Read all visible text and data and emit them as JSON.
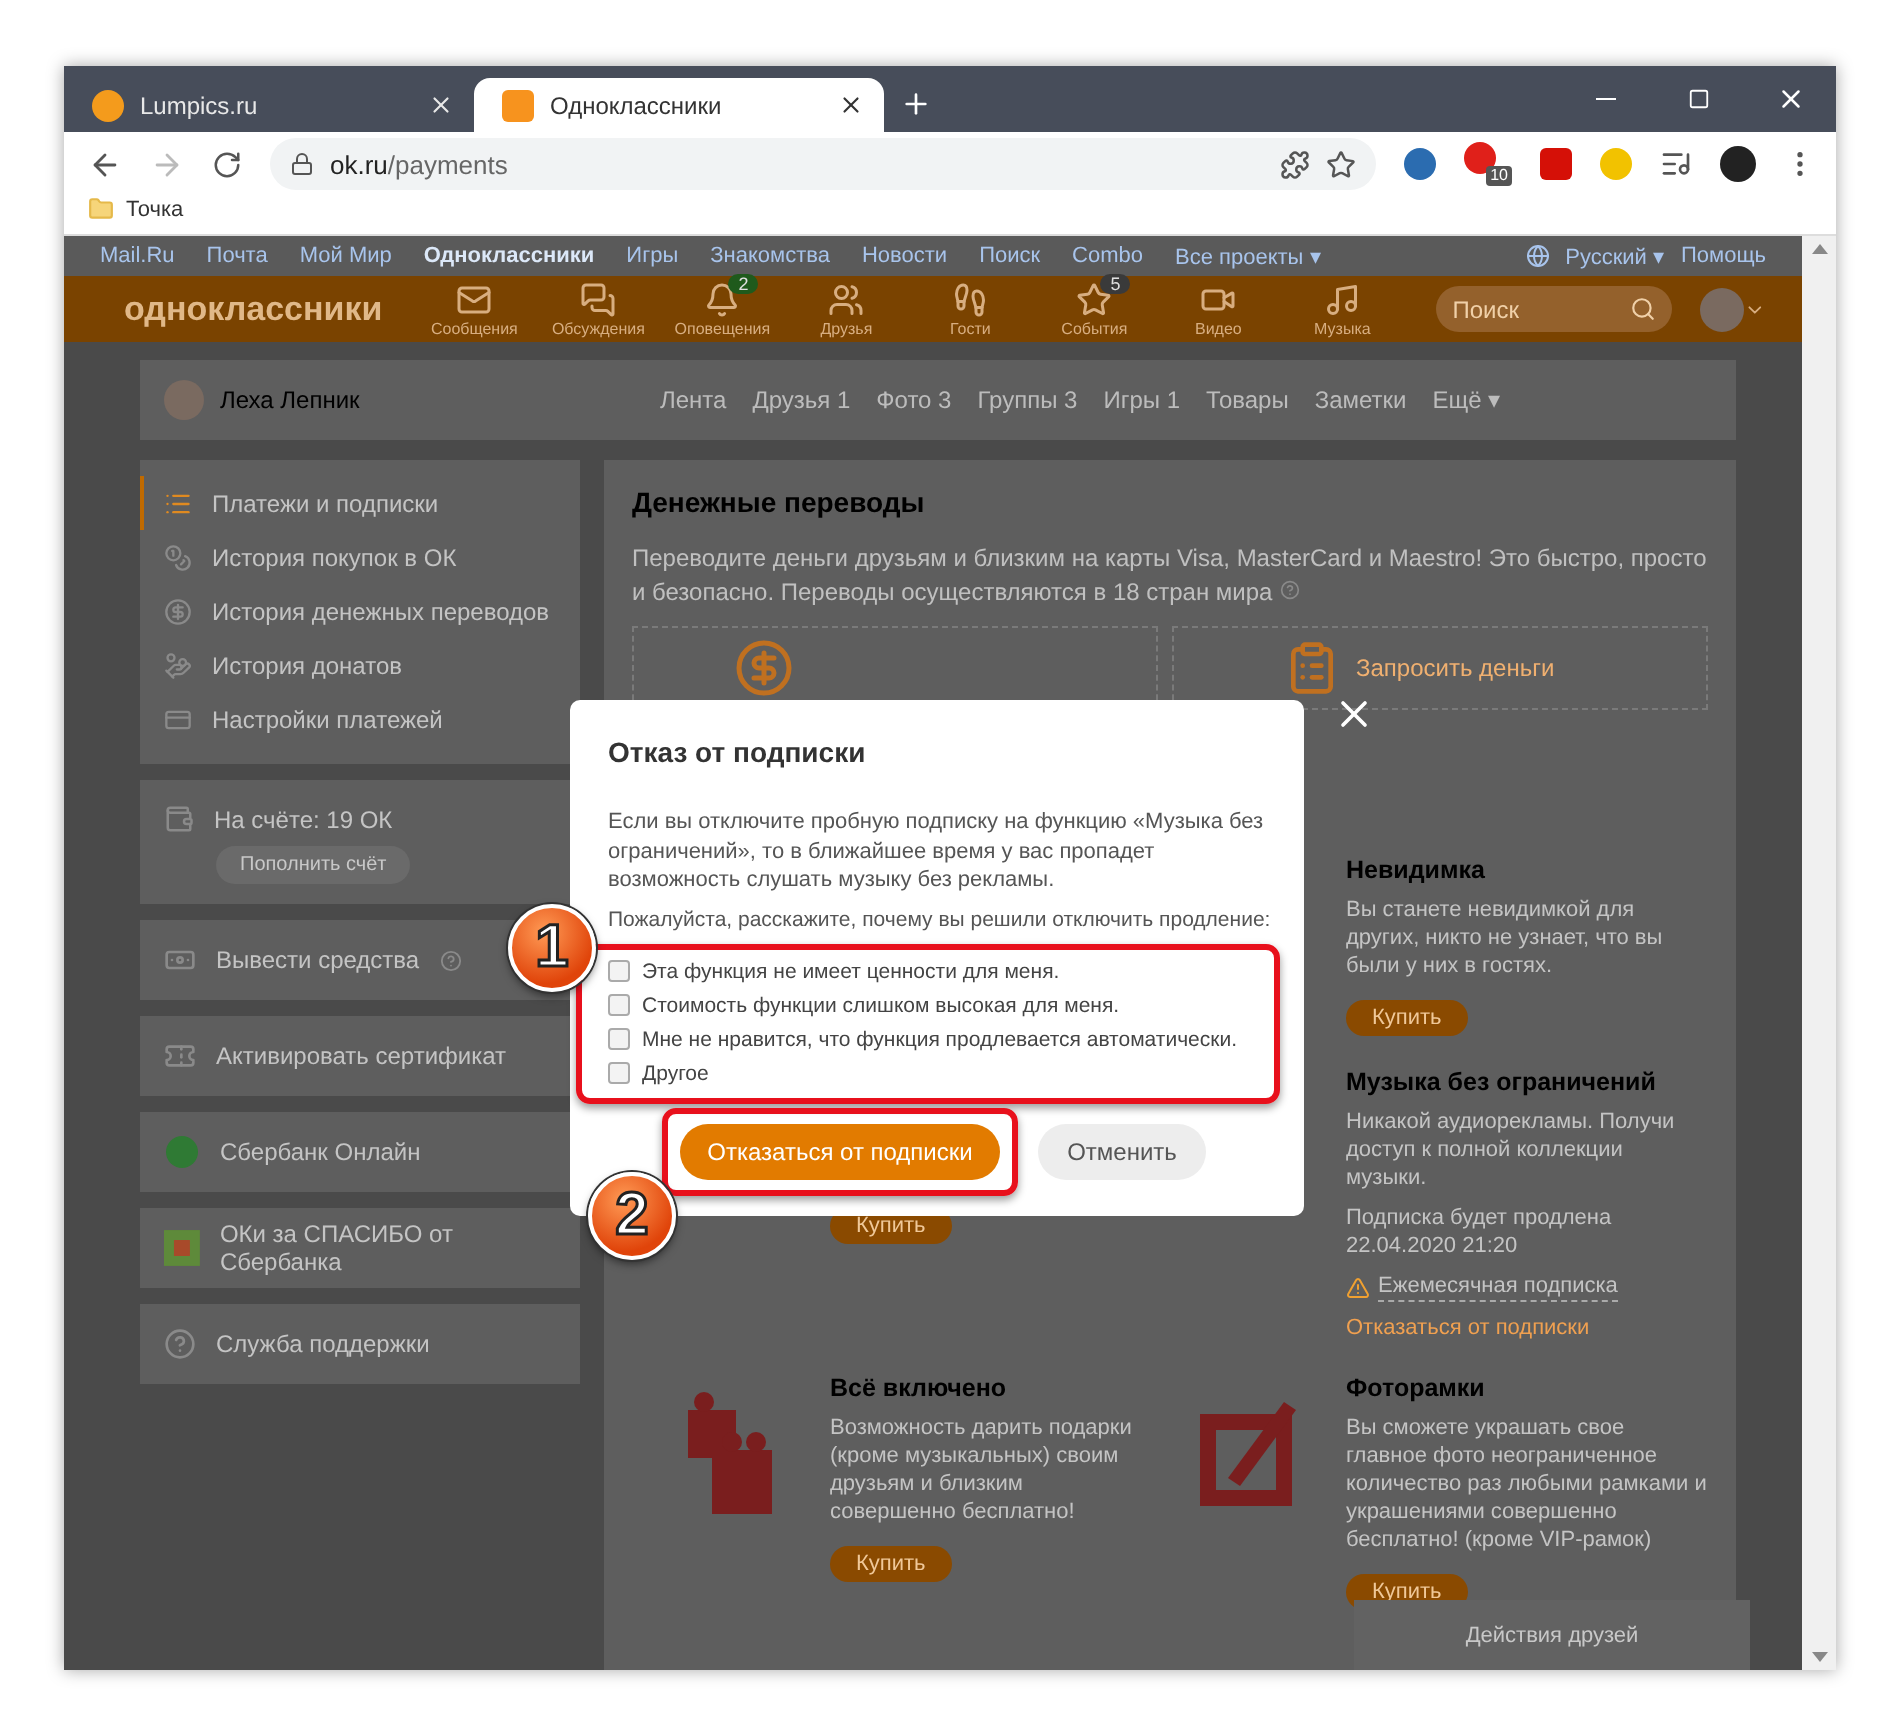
{
  "browser": {
    "tabs": [
      {
        "title": "Lumpics.ru",
        "selected": false,
        "kind": "lumpics"
      },
      {
        "title": "Одноклассники",
        "selected": true,
        "kind": "ok"
      }
    ],
    "address": {
      "host": "ok.ru",
      "path": "/payments"
    },
    "extension_badge": "10",
    "bookmarks": [
      "Точка"
    ]
  },
  "portal_bar": {
    "links": [
      {
        "label": "Mail.Ru",
        "selected": false
      },
      {
        "label": "Почта",
        "selected": false
      },
      {
        "label": "Мой Мир",
        "selected": false
      },
      {
        "label": "Одноклассники",
        "selected": true
      },
      {
        "label": "Игры",
        "selected": false
      },
      {
        "label": "Знакомства",
        "selected": false
      },
      {
        "label": "Новости",
        "selected": false
      },
      {
        "label": "Поиск",
        "selected": false
      },
      {
        "label": "Combo",
        "selected": false
      },
      {
        "label": "Все проекты ▾",
        "selected": false
      }
    ],
    "language": "Русский ▾",
    "help": "Помощь"
  },
  "header": {
    "logo": "одноклассники",
    "nav": [
      {
        "label": "Сообщения",
        "kind": "messages"
      },
      {
        "label": "Обсуждения",
        "kind": "discussions"
      },
      {
        "label": "Оповещения",
        "kind": "notifications",
        "badge": "2"
      },
      {
        "label": "Друзья",
        "kind": "friends"
      },
      {
        "label": "Гости",
        "kind": "guests"
      },
      {
        "label": "События",
        "kind": "events",
        "badge": "5"
      },
      {
        "label": "Видео",
        "kind": "video"
      },
      {
        "label": "Музыка",
        "kind": "music"
      }
    ],
    "search": {
      "placeholder": "Поиск"
    }
  },
  "profile": {
    "name": "Леха Лепник",
    "tabs": [
      "Лента",
      "Друзья 1",
      "Фото 3",
      "Группы 3",
      "Игры 1",
      "Товары",
      "Заметки",
      "Ещё ▾"
    ]
  },
  "sidebar": {
    "menu": [
      {
        "label": "Платежи и подписки",
        "kind": "list",
        "selected": true
      },
      {
        "label": "История покупок в ОК",
        "kind": "coins",
        "selected": false
      },
      {
        "label": "История денежных переводов",
        "kind": "ruble",
        "selected": false
      },
      {
        "label": "История донатов",
        "kind": "donate",
        "selected": false
      },
      {
        "label": "Настройки платежей",
        "kind": "card",
        "selected": false
      }
    ],
    "balance": {
      "label": "На счёте: 19 ОК",
      "button": "Пополнить счёт"
    },
    "cards": [
      {
        "label": "Вывести средства",
        "kind": "withdraw",
        "help": true
      },
      {
        "label": "Активировать сертификат",
        "kind": "certificate",
        "help": false
      },
      {
        "label": "Сбербанк Онлайн",
        "kind": "sber",
        "help": false
      },
      {
        "label": "ОКи за СПАСИБО от Сбербанка",
        "kind": "spasibo",
        "help": false
      },
      {
        "label": "Служба поддержки",
        "kind": "support",
        "help": false
      }
    ]
  },
  "transfers": {
    "title": "Денежные переводы",
    "description": "Переводите деньги друзьям и близким на карты Visa, MasterCard и Maestro! Это быстро, просто и безопасно. Переводы осуществляются в 18 стран мира",
    "request_label": "Запросить деньги"
  },
  "products": [
    {
      "title": "Невидимка",
      "description": "Вы станете невидимкой для других, никто не узнает, что вы были у них в гостях.",
      "buy": "Купить",
      "kind": "plain"
    },
    {
      "buy": "Купить",
      "kind": "plain"
    },
    {
      "title": "Музыка без ограничений",
      "description": "Никакой аудиорекламы. Получи доступ к полной коллекции музыки.",
      "renewal": "Подписка будет продлена 22.04.2020 21:20",
      "plan": "Ежемесячная подписка",
      "cancel": "Отказаться от подписки",
      "kind": "plain"
    },
    {
      "title": "Всё включено",
      "description": "Возможность дарить подарки (кроме музыкальных) своим друзьям и близким совершенно бесплатно!",
      "buy": "Купить",
      "kind": "gifts"
    },
    {
      "title": "Фоторамки",
      "description": "Вы сможете украшать свое главное фото неограниченное количество раз любыми рамками и украшениями совершенно бесплатно! (кроме VIP-рамок)",
      "buy": "Купить",
      "kind": "frame"
    }
  ],
  "friends_panel": "Действия друзей",
  "dialog": {
    "title": "Отказ от подписки",
    "text": "Если вы отключите пробную подписку на функцию «Музыка без ограничений», то в ближайшее время у вас пропадет возможность слушать музыку без рекламы.",
    "question": "Пожалуйста, расскажите, почему вы решили отключить продление:",
    "reasons": [
      {
        "label": "Эта функция не имеет ценности для меня.",
        "checked": false
      },
      {
        "label": "Стоимость функции слишком высокая для меня.",
        "checked": false
      },
      {
        "label": "Мне не нравится, что функция продлевается автоматически.",
        "checked": false
      },
      {
        "label": "Другое",
        "checked": false
      }
    ],
    "confirm": "Отказаться от подписки",
    "cancel": "Отменить"
  },
  "annotations": [
    "1",
    "2"
  ]
}
